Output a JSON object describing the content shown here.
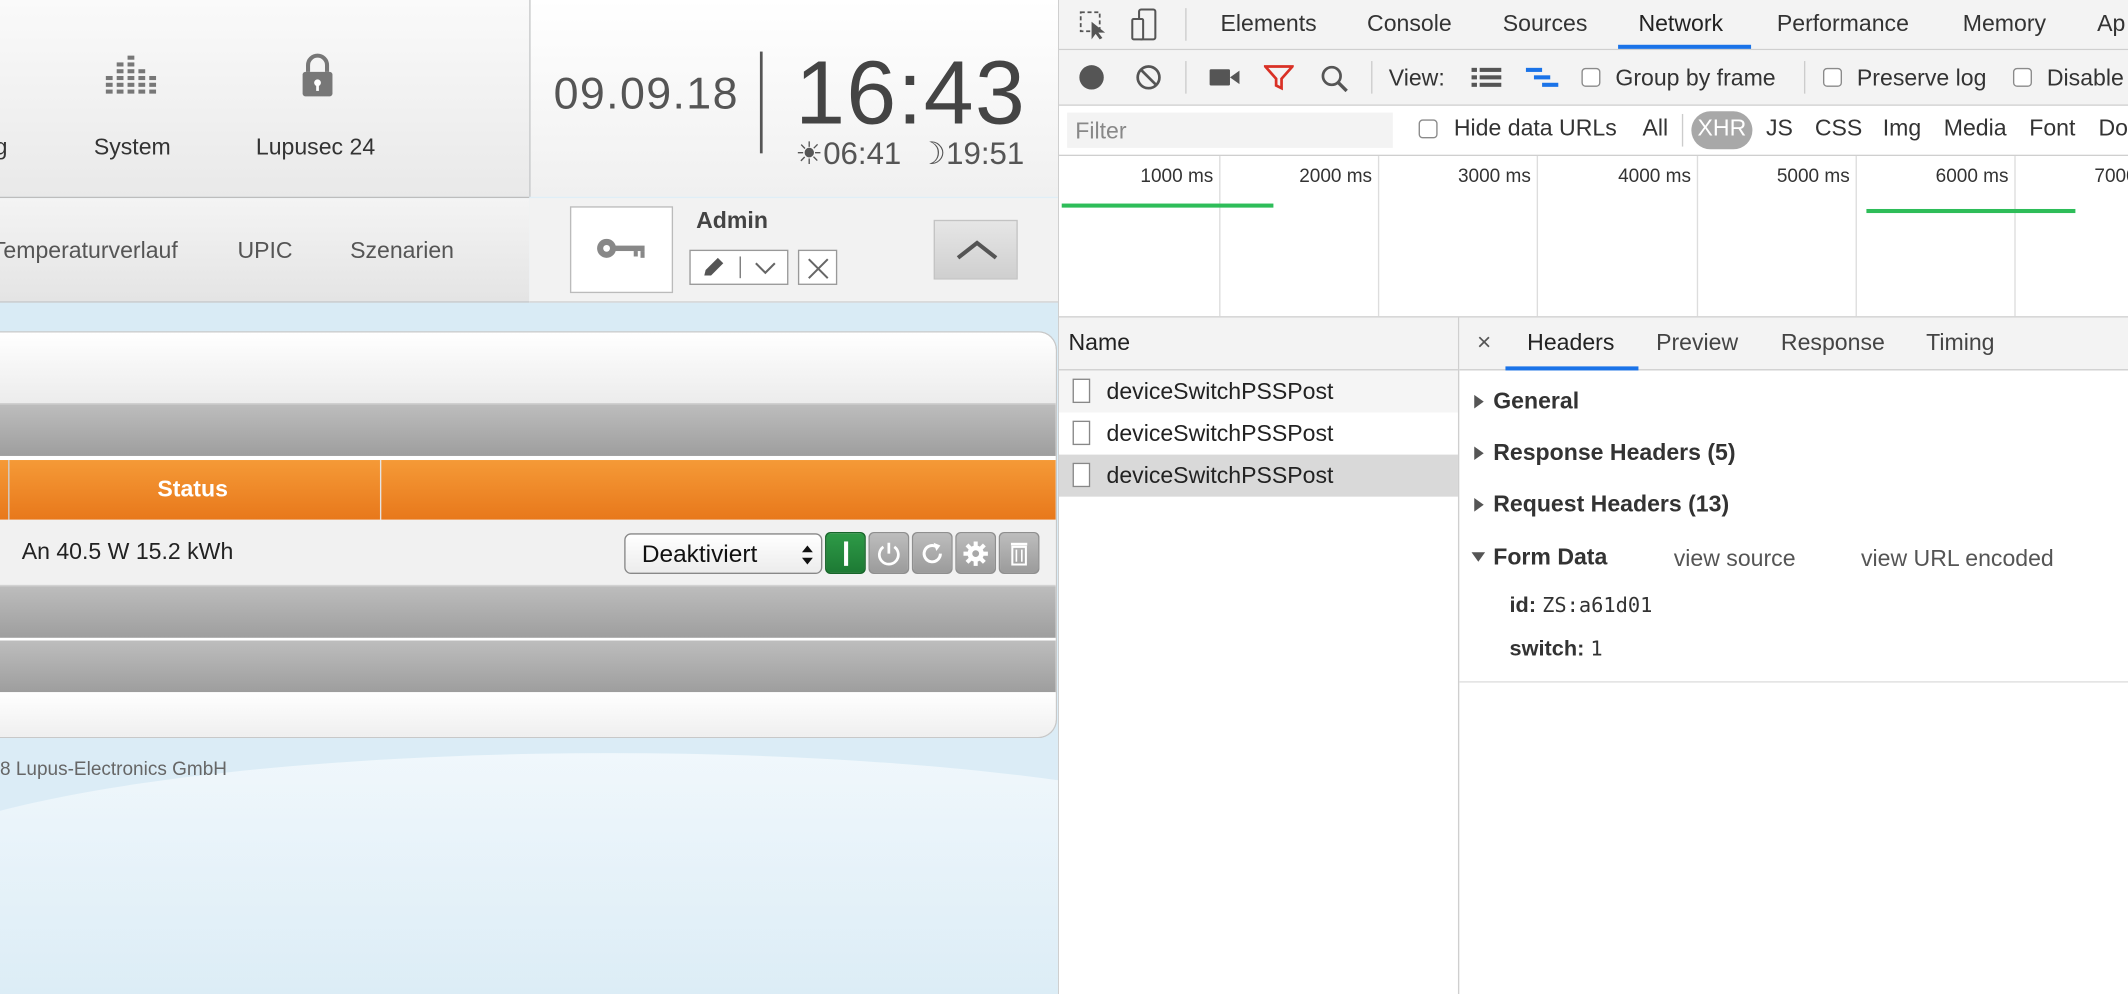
{
  "lupusec": {
    "nav": {
      "partial_label": "g",
      "system_label": "System",
      "lupusec24_label": "Lupusec 24"
    },
    "clock": {
      "date": "09.09.18",
      "time": "16:43",
      "sunrise": "06:41",
      "sunset": "19:51"
    },
    "sublinks": [
      "Temperaturverlauf",
      "UPIC",
      "Szenarien"
    ],
    "user": {
      "name": "Admin"
    },
    "table": {
      "status_header": "Status",
      "row_status": "An 40.5 W 15.2 kWh",
      "select_value": "Deaktiviert"
    },
    "footer": "8 Lupus-Electronics GmbH"
  },
  "devtools": {
    "tabs": [
      "Elements",
      "Console",
      "Sources",
      "Network",
      "Performance",
      "Memory",
      "Ap"
    ],
    "active_tab": "Network",
    "toolbar": {
      "view_label": "View:",
      "group_by_frame": "Group by frame",
      "preserve_log": "Preserve log",
      "disable_cache": "Disable"
    },
    "filter": {
      "placeholder": "Filter",
      "hide_data_urls": "Hide data URLs",
      "types": [
        "All",
        "XHR",
        "JS",
        "CSS",
        "Img",
        "Media",
        "Font",
        "Do"
      ],
      "active_type": "XHR"
    },
    "timeline": {
      "ticks": [
        "1000 ms",
        "2000 ms",
        "3000 ms",
        "4000 ms",
        "5000 ms",
        "6000 ms",
        "7000"
      ]
    },
    "requests": {
      "column_name": "Name",
      "items": [
        "deviceSwitchPSSPost",
        "deviceSwitchPSSPost",
        "deviceSwitchPSSPost"
      ]
    },
    "details": {
      "close": "×",
      "tabs": [
        "Headers",
        "Preview",
        "Response",
        "Timing"
      ],
      "active_tab": "Headers",
      "general": "General",
      "response_headers": "Response Headers (5)",
      "request_headers": "Request Headers (13)",
      "form_data": "Form Data",
      "view_source": "view source",
      "view_url_encoded": "view URL encoded",
      "fields": [
        {
          "key": "id:",
          "value": "ZS:a61d01"
        },
        {
          "key": "switch:",
          "value": "1"
        }
      ]
    }
  }
}
